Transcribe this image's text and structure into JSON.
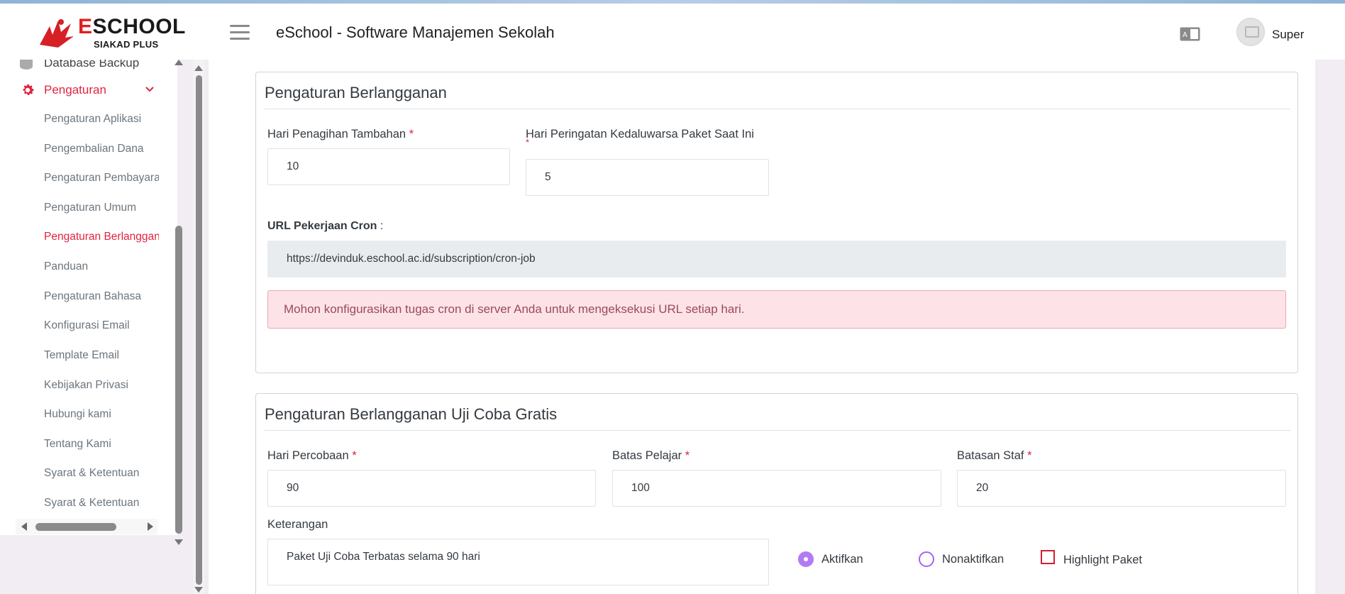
{
  "brand": {
    "name_first": "E",
    "name_rest": "SCHOOL",
    "subtitle": "SIAKAD PLUS"
  },
  "header": {
    "title": "eSchool - Software Manajemen Sekolah",
    "user_name": "Super"
  },
  "sidebar": {
    "db_backup": "Database Backup",
    "parent": "Pengaturan",
    "items": [
      {
        "label": "Pengaturan Aplikasi"
      },
      {
        "label": "Pengembalian Dana"
      },
      {
        "label": "Pengaturan Pembayaran"
      },
      {
        "label": "Pengaturan Umum"
      },
      {
        "label": "Pengaturan Berlangganan"
      },
      {
        "label": "Panduan"
      },
      {
        "label": "Pengaturan Bahasa"
      },
      {
        "label": "Konfigurasi Email"
      },
      {
        "label": "Template Email"
      },
      {
        "label": "Kebijakan Privasi"
      },
      {
        "label": "Hubungi kami"
      },
      {
        "label": "Tentang Kami"
      },
      {
        "label": "Syarat & Ketentuan"
      },
      {
        "label": "Syarat & Ketentuan"
      }
    ]
  },
  "subscription": {
    "title": "Pengaturan Berlangganan",
    "extra_billing_label": "Hari Penagihan Tambahan",
    "extra_billing_value": "10",
    "expiry_warning_label": "Hari Peringatan Kedaluwarsa Paket Saat Ini",
    "expiry_warning_value": "5",
    "cron_label": "URL Pekerjaan Cron",
    "cron_colon": " :",
    "cron_url": "https://devinduk.eschool.ac.id/subscription/cron-job",
    "alert": "Mohon konfigurasikan tugas cron di server Anda untuk mengeksekusi URL setiap hari."
  },
  "trial": {
    "title": "Pengaturan Berlangganan Uji Coba Gratis",
    "days_label": "Hari Percobaan",
    "days_value": "90",
    "student_label": "Batas Pelajar",
    "student_value": "100",
    "staff_label": "Batasan Staf",
    "staff_value": "20",
    "desc_label": "Keterangan",
    "desc_value": "Paket Uji Coba Terbatas selama 90 hari",
    "enable_label": "Aktifkan",
    "disable_label": "Nonaktifkan",
    "highlight_label": "Highlight Paket",
    "enabled": true,
    "highlighted": false
  },
  "required_mark": "*",
  "colors": {
    "accent": "#e1243f",
    "radio": "#b37bf3",
    "alert_bg": "#fde3e7"
  }
}
